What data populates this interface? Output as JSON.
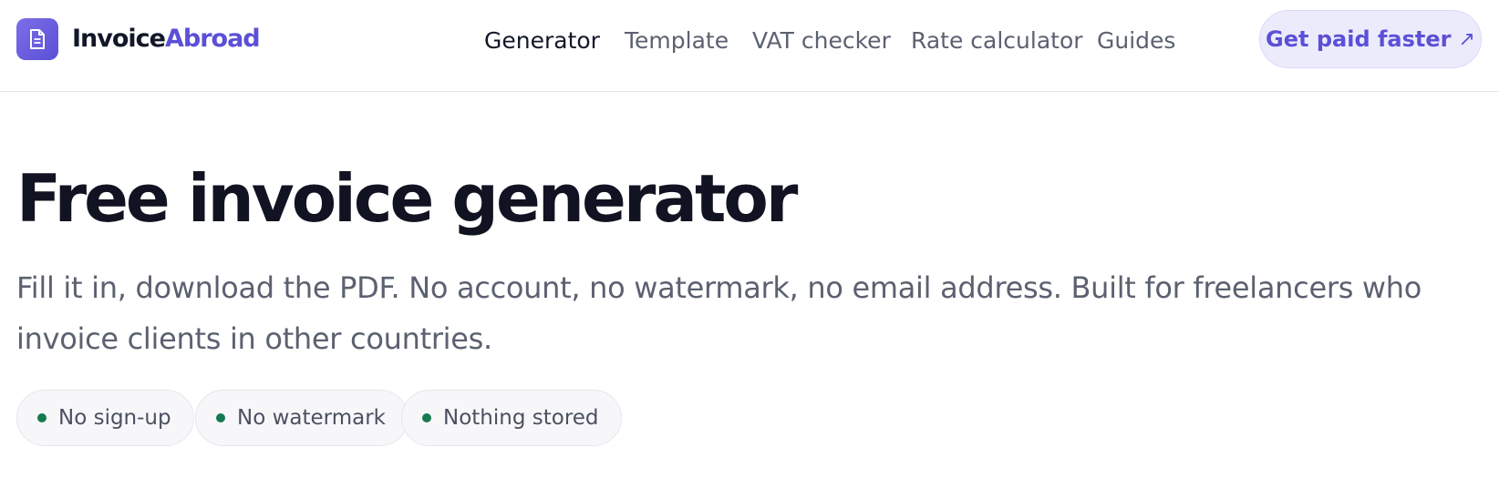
{
  "brand": {
    "name_part1": "Invoice",
    "name_part2": "Abroad",
    "logo_icon": "document-icon",
    "accent_color": "#5b50d6"
  },
  "nav": {
    "items": [
      {
        "label": "Generator",
        "active": true
      },
      {
        "label": "Template",
        "active": false
      },
      {
        "label": "VAT checker",
        "active": false
      },
      {
        "label": "Rate calculator",
        "active": false
      },
      {
        "label": "Guides",
        "active": false
      }
    ],
    "cta_label": "Get paid faster",
    "cta_icon": "arrow-up-right-icon",
    "cta_arrow": "↗"
  },
  "hero": {
    "title": "Free invoice generator",
    "subtitle": "Fill it in, download the PDF. No account, no watermark, no email address. Built for freelancers who invoice clients in other countries."
  },
  "badges": [
    {
      "label": "No sign-up",
      "dot_color": "#157a4f"
    },
    {
      "label": "No watermark",
      "dot_color": "#157a4f"
    },
    {
      "label": "Nothing stored",
      "dot_color": "#157a4f"
    }
  ]
}
